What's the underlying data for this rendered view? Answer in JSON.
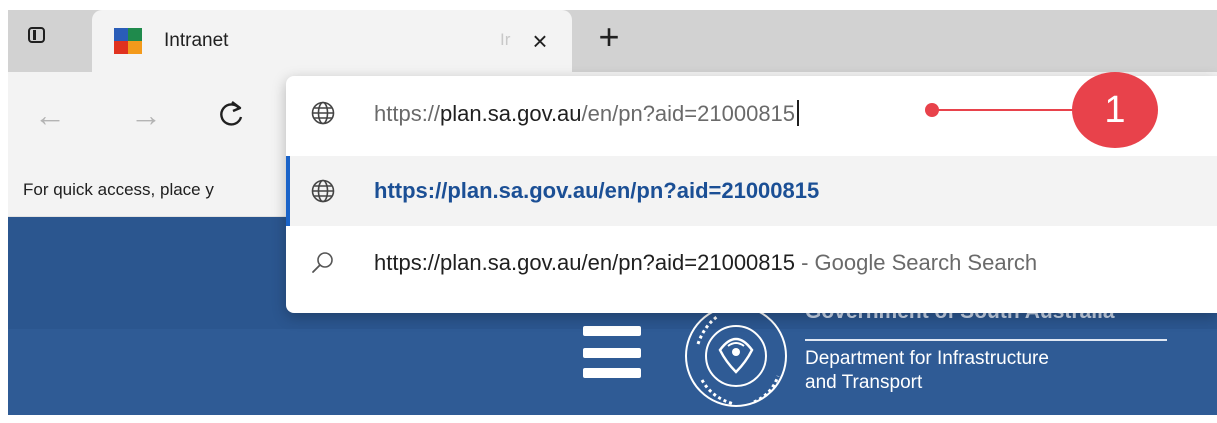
{
  "browser": {
    "tab": {
      "title": "Intranet",
      "faded_title": "Ir",
      "close_glyph": "×"
    },
    "new_tab_glyph": "+",
    "nav": {
      "back_glyph": "←",
      "forward_glyph": "→",
      "reload_glyph": "↻"
    },
    "favorites_bar_text": "For quick access, place y"
  },
  "omnibox": {
    "input": {
      "scheme": "https://",
      "host": "plan.sa.gov.au",
      "path": "/en/pn?aid=21000815",
      "icon": "globe-icon"
    },
    "suggestions": [
      {
        "text": "https://plan.sa.gov.au/en/pn?aid=21000815",
        "suffix": "",
        "icon": "globe-icon",
        "selected": true
      },
      {
        "text": "https://plan.sa.gov.au/en/pn?aid=21000815",
        "suffix": " - Google Search Search",
        "icon": "search-icon",
        "selected": false
      }
    ]
  },
  "page": {
    "gov_title": "Government of South Australia",
    "dept_line1": "Department for Infrastructure",
    "dept_line2": "and Transport",
    "seal_icon": "sa-government-seal"
  },
  "callout": {
    "label": "1",
    "color": "#e8424b"
  },
  "colors": {
    "header_blue": "#2b568f",
    "accent_blue": "#1a63c8",
    "link_blue": "#1b4f95"
  }
}
